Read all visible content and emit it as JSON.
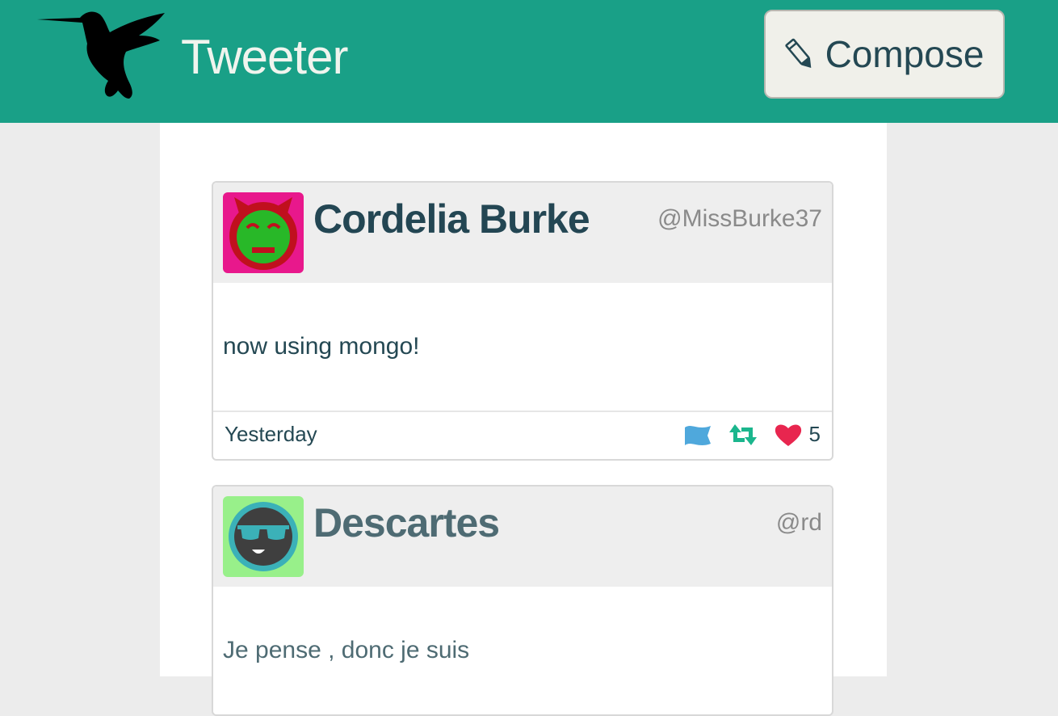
{
  "app": {
    "brand": "Tweeter",
    "compose_label": "Compose"
  },
  "colors": {
    "topbar": "#19a087",
    "text_dark": "#244853",
    "flag": "#4fa8dc",
    "retweet": "#1bb68d",
    "heart": "#e8264f"
  },
  "tweets": [
    {
      "name": "Cordelia Burke",
      "handle": "@MissBurke37",
      "text": "now using mongo!",
      "date": "Yesterday",
      "likes": "5",
      "avatar_icon": "devil-face-avatar",
      "avatar_bg": "#e8188c"
    },
    {
      "name": "Descartes",
      "handle": "@rd",
      "text": "Je pense , donc je suis",
      "avatar_icon": "sunglasses-face-avatar",
      "avatar_bg": "#98f08a"
    }
  ],
  "icons": {
    "logo": "hummingbird-icon",
    "compose": "pencil-icon",
    "flag": "flag-icon",
    "retweet": "retweet-icon",
    "like": "heart-icon"
  }
}
